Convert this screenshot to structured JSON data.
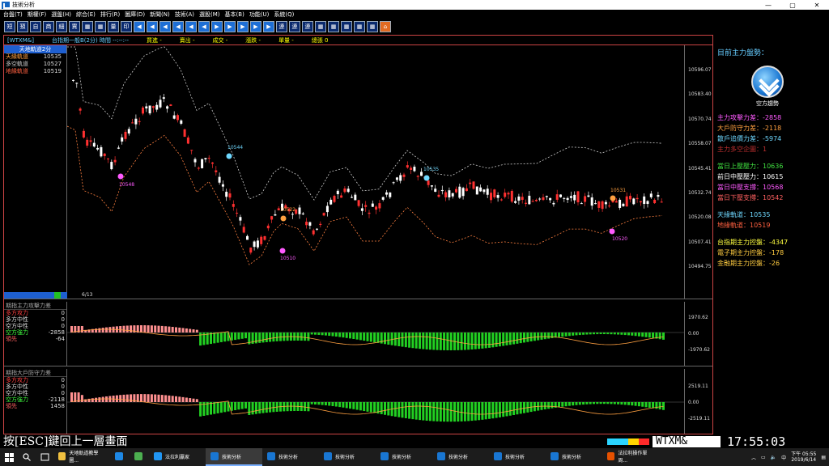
{
  "window": {
    "title": "技術分析",
    "controls": [
      "—",
      "▢",
      "✕"
    ]
  },
  "menu": [
    "台盤(T)",
    "期權(F)",
    "選盤(H)",
    "綜合(E)",
    "排行(R)",
    "圖庫(D)",
    "新聞(N)",
    "技術(A)",
    "選股(M)",
    "基本(B)",
    "功能(U)",
    "系統(Q)"
  ],
  "toolbar": {
    "buttons": [
      "短",
      "預",
      "自",
      "商",
      "細",
      "賈",
      "▦",
      "▦",
      "量",
      "印",
      "◀",
      "◀",
      "◀",
      "◀",
      "◀",
      "◀",
      "▶",
      "▶",
      "▶",
      "▶",
      "▶",
      "連",
      "連",
      "連",
      "▦",
      "▦",
      "▦",
      "▦",
      "▦",
      "⌂"
    ]
  },
  "infobar": {
    "symbol": "[WTXM&]",
    "desc": "台指期一般B(2分) 時間 --:--:--",
    "buy": "買進 -",
    "sell": "賣出 -",
    "deal": "成交 -",
    "change": "漲跌 -",
    "volume": "單量 -",
    "total": "總張 0"
  },
  "leftpanel": {
    "header": "天地軌道2分",
    "rows": [
      {
        "label": "天緣軌道",
        "value": "10535",
        "color": "#ff9f40"
      },
      {
        "label": "多空軌道",
        "value": "10527",
        "color": "#cccccc"
      },
      {
        "label": "地緣軌道",
        "value": "10519",
        "color": "#ff6040"
      }
    ]
  },
  "price_axis": [
    "10596.07",
    "10583.40",
    "10570.74",
    "10558.07",
    "10545.41",
    "10532.74",
    "10520.08",
    "10507.41",
    "10494.75"
  ],
  "date_label": "6/13",
  "markers": [
    "10544",
    "10548",
    "10522",
    "10510",
    "10535",
    "10531",
    "10520"
  ],
  "sub1": {
    "title": "期指主力攻擊力差",
    "rows": [
      {
        "label": "多方攻力",
        "value": "0",
        "color": "#ff4040"
      },
      {
        "label": "多方中性",
        "value": "0",
        "color": "#ffffff"
      },
      {
        "label": "空方中性",
        "value": "0",
        "color": "#ffffff"
      },
      {
        "label": "空方強力",
        "value": "-2858",
        "color": "#40ff40"
      },
      {
        "label": "領先",
        "value": "-64",
        "color": "#ff6060"
      }
    ],
    "axis": [
      "1970.62",
      "0.00",
      "-1970.62"
    ]
  },
  "sub2": {
    "title": "期指大戶防守力差",
    "rows": [
      {
        "label": "多方攻力",
        "value": "0",
        "color": "#ff4040"
      },
      {
        "label": "多方中性",
        "value": "0",
        "color": "#ffffff"
      },
      {
        "label": "空方中性",
        "value": "0",
        "color": "#ffffff"
      },
      {
        "label": "空方強力",
        "value": "-2118",
        "color": "#40ff40"
      },
      {
        "label": "領先",
        "value": "1458",
        "color": "#ff6060"
      }
    ],
    "axis": [
      "2519.11",
      "0.00",
      "-2519.11"
    ]
  },
  "rightpanel": {
    "title": "目前主力盤勢：",
    "trend": "空方趨勢",
    "group1": [
      {
        "text": "主力攻擊力差：-2858",
        "color": "#ff5aff"
      },
      {
        "text": "大戶防守力差：-2118",
        "color": "#ffa040"
      },
      {
        "text": "散戶追價力差：-5974",
        "color": "#6fd8ff"
      },
      {
        "text": "主力多空企圖：1",
        "color": "#c03030"
      }
    ],
    "group2": [
      {
        "text": "當日上壓壓力：10636",
        "color": "#40e040"
      },
      {
        "text": "前日中壓壓力：10615",
        "color": "#ffffff"
      },
      {
        "text": "當日中壓支撐：10568",
        "color": "#ff5aff"
      },
      {
        "text": "當日下壓支撐：10542",
        "color": "#ff6060"
      }
    ],
    "group3": [
      {
        "text": "天緣軌道：10535",
        "color": "#6fd8ff"
      },
      {
        "text": "地緣軌道：10519",
        "color": "#ff6040"
      }
    ],
    "group4": [
      {
        "text": "台指期主力控盤：-4347",
        "color": "#ffff40"
      },
      {
        "text": "電子期主力控盤：-178",
        "color": "#ffcc40"
      },
      {
        "text": "金融期主力控盤：-26",
        "color": "#ffcc40"
      }
    ]
  },
  "status": {
    "message": "按[ESC]鍵回上一層畫面",
    "code": "WTXM&",
    "clock": "17:55:03"
  },
  "taskbar": {
    "apps": [
      {
        "label": "天地軌道教學圖...",
        "color": "#f0c040",
        "active": false
      },
      {
        "label": "",
        "color": "#1e88e5",
        "active": false
      },
      {
        "label": "",
        "color": "#4caf50",
        "active": false
      },
      {
        "label": "法拉利贏家",
        "color": "#2196f3",
        "active": false
      },
      {
        "label": "技術分析",
        "color": "#1976d2",
        "active": true
      },
      {
        "label": "技術分析",
        "color": "#1976d2",
        "active": false
      },
      {
        "label": "技術分析",
        "color": "#1976d2",
        "active": false
      },
      {
        "label": "技術分析",
        "color": "#1976d2",
        "active": false
      },
      {
        "label": "技術分析",
        "color": "#1976d2",
        "active": false
      },
      {
        "label": "技術分析",
        "color": "#1976d2",
        "active": false
      },
      {
        "label": "技術分析",
        "color": "#1976d2",
        "active": false
      },
      {
        "label": "法拉利操作單周...",
        "color": "#e65100",
        "active": false
      }
    ],
    "time": "下午 05:55",
    "date": "2019/6/14"
  }
}
